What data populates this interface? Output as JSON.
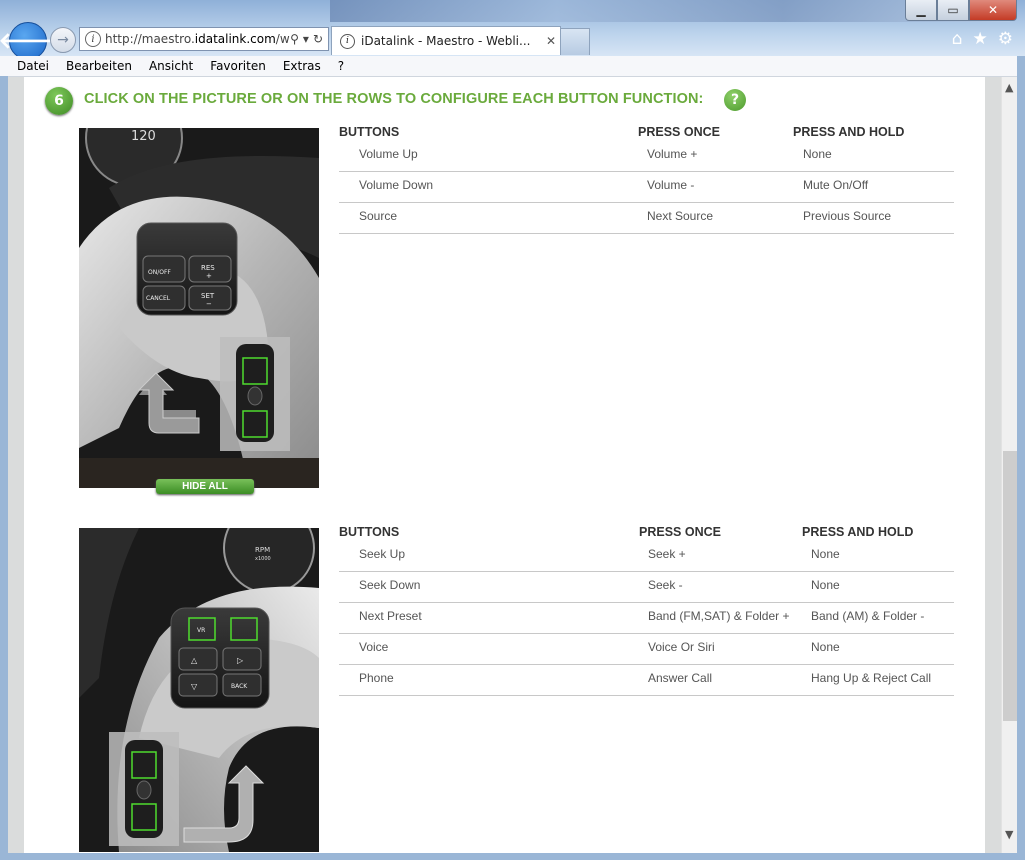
{
  "browser": {
    "address": {
      "prefix": "http://maestro.",
      "domain": "idatalink.com",
      "suffix": "/w"
    },
    "tab_title": "iDatalink - Maestro - Webli...",
    "tab_close": "✕"
  },
  "menu": [
    "Datei",
    "Bearbeiten",
    "Ansicht",
    "Favoriten",
    "Extras",
    "?"
  ],
  "step": {
    "number": "6",
    "heading": "CLICK ON THE PICTURE OR ON THE ROWS TO CONFIGURE EACH BUTTON FUNCTION:",
    "help": "?"
  },
  "image1": {
    "labels": [
      "120",
      "ON/OFF",
      "RES",
      "+",
      "CANCEL",
      "SET",
      "−"
    ]
  },
  "image2": {
    "labels": [
      "RPM",
      "x1000",
      "VR",
      "BACK"
    ]
  },
  "hide_all": "HIDE ALL",
  "table1": {
    "headers": [
      "BUTTONS",
      "PRESS ONCE",
      "PRESS AND HOLD"
    ],
    "rows": [
      [
        "Volume Up",
        "Volume +",
        "None"
      ],
      [
        "Volume Down",
        "Volume -",
        "Mute On/Off"
      ],
      [
        "Source",
        "Next Source",
        "Previous Source"
      ]
    ]
  },
  "table2": {
    "headers": [
      "BUTTONS",
      "PRESS ONCE",
      "PRESS AND HOLD"
    ],
    "rows": [
      [
        "Seek Up",
        "Seek +",
        "None"
      ],
      [
        "Seek Down",
        "Seek -",
        "None"
      ],
      [
        "Next Preset",
        "Band (FM,SAT) & Folder +",
        "Band (AM) & Folder -"
      ],
      [
        "Voice",
        "Voice Or Siri",
        "None"
      ],
      [
        "Phone",
        "Answer Call",
        "Hang Up & Reject Call"
      ]
    ]
  }
}
